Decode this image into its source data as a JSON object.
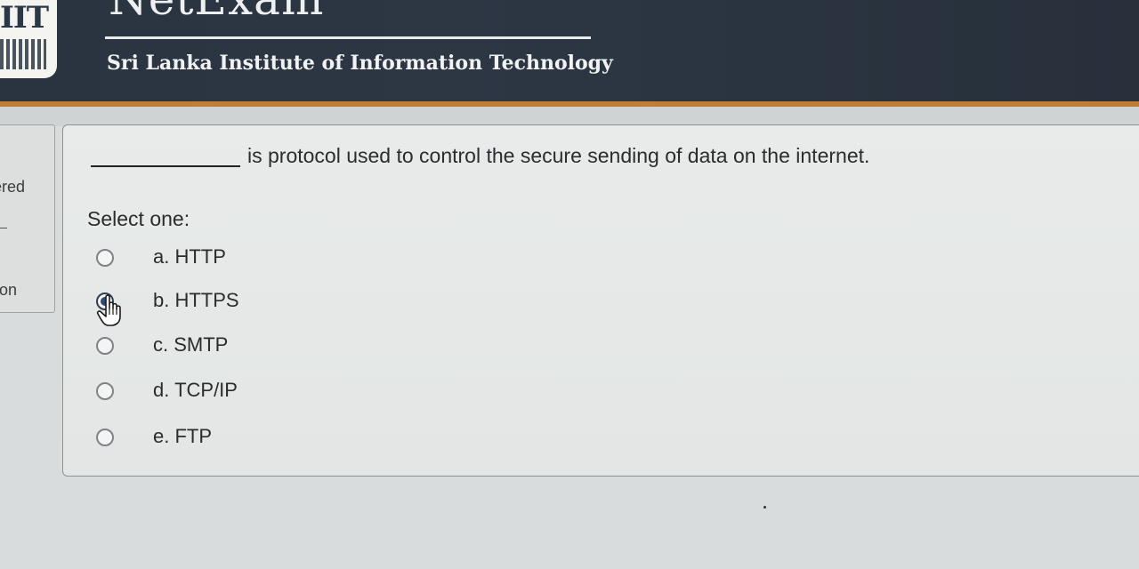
{
  "header": {
    "logo_text": "IIT",
    "app_title": "NetExam",
    "institute": "Sri Lanka Institute of Information Technology"
  },
  "info_panel": {
    "line1": "ered",
    "line2": "on"
  },
  "question": {
    "text": "is protocol used to control the secure sending of data on the internet.",
    "prompt": "Select one:",
    "options": [
      {
        "label": "a. HTTP",
        "selected": false
      },
      {
        "label": "b. HTTPS",
        "selected": true
      },
      {
        "label": "c. SMTP",
        "selected": false
      },
      {
        "label": "d. TCP/IP",
        "selected": false
      },
      {
        "label": "e. FTP",
        "selected": false
      }
    ]
  },
  "icons": {
    "cursor": "hand-pointer-icon",
    "radio": "radio-button-icon"
  },
  "colors": {
    "header_bg": "#2a3440",
    "accent_bar": "#c47a3c",
    "selected_radio": "#2a4b7c"
  }
}
